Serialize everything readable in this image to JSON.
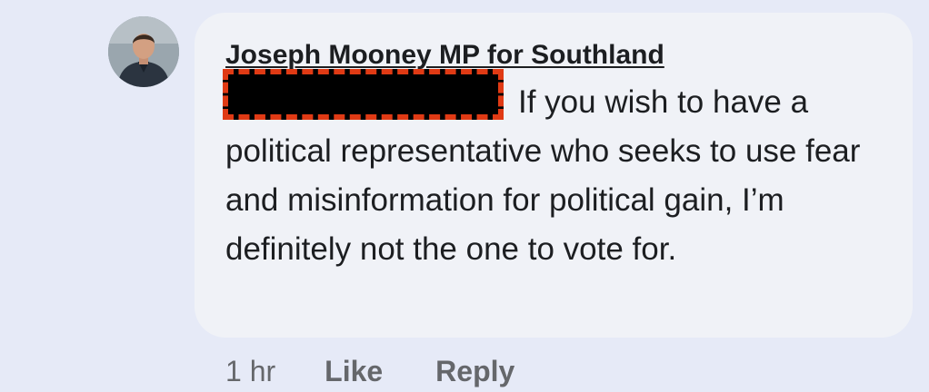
{
  "comment": {
    "author": "Joseph Mooney MP for Southland",
    "text": "If you wish to have a political representative who seeks to use fear and misinformation for political gain, I’m definitely not the one to vote for.",
    "timestamp": "1 hr",
    "like_label": "Like",
    "reply_label": "Reply",
    "avatar_icon": "profile-photo-icon"
  },
  "colors": {
    "page_background": "#e6eaf7",
    "bubble_background": "#f0f2f7",
    "redaction_fill": "#000000",
    "redaction_border": "#e03a14",
    "meta_text": "#65676b"
  }
}
